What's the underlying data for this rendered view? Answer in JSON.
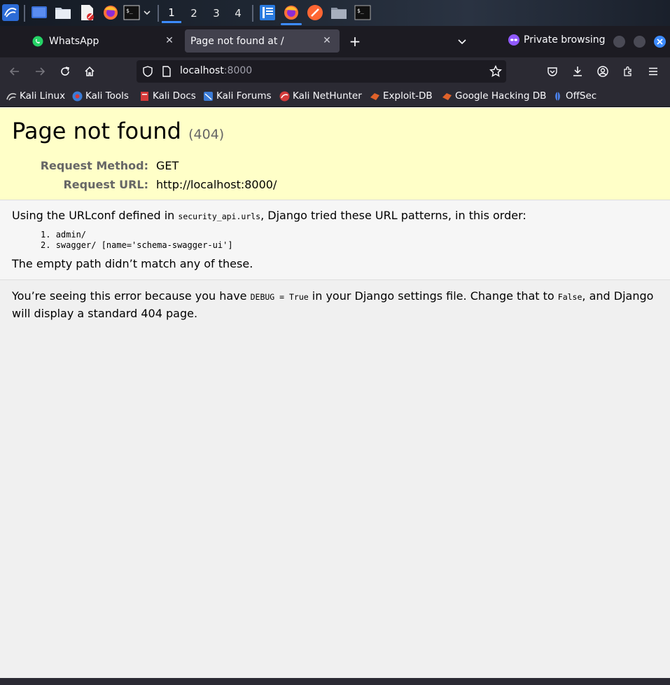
{
  "taskbar": {
    "workspaces": [
      "1",
      "2",
      "3",
      "4"
    ],
    "active_workspace": "1"
  },
  "tabs": [
    {
      "title": "WhatsApp",
      "icon": "whatsapp-icon",
      "active": false
    },
    {
      "title": "Page not found at /",
      "icon": "none",
      "active": true
    }
  ],
  "private_browsing_label": "Private browsing",
  "url": {
    "host": "localhost",
    "port": ":8000"
  },
  "bookmarks": [
    {
      "label": "Kali Linux",
      "icon": "kali-dragon-icon",
      "color": "#d0d0d0"
    },
    {
      "label": "Kali Tools",
      "icon": "kali-tools-icon",
      "color": "#3b7bd6"
    },
    {
      "label": "Kali Docs",
      "icon": "kali-docs-icon",
      "color": "#d43a3a"
    },
    {
      "label": "Kali Forums",
      "icon": "kali-forums-icon",
      "color": "#3b7bd6"
    },
    {
      "label": "Kali NetHunter",
      "icon": "nethunter-icon",
      "color": "#d43a3a"
    },
    {
      "label": "Exploit-DB",
      "icon": "exploit-db-icon",
      "color": "#e0622a"
    },
    {
      "label": "Google Hacking DB",
      "icon": "ghdb-icon",
      "color": "#e0622a"
    },
    {
      "label": "OffSec",
      "icon": "offsec-icon",
      "color": "#4a80e8"
    }
  ],
  "page": {
    "title": "Page not found",
    "status_code": "(404)",
    "request_method_label": "Request Method:",
    "request_method": "GET",
    "request_url_label": "Request URL:",
    "request_url": "http://localhost:8000/",
    "urlconf_prefix": "Using the URLconf defined in ",
    "urlconf_module": "security_api.urls",
    "urlconf_suffix": ", Django tried these URL patterns, in this order:",
    "patterns": [
      "admin/",
      "swagger/ [name='schema-swagger-ui']"
    ],
    "empty_path_message": "The empty path didn’t match any of these.",
    "explanation_part1": "You’re seeing this error because you have ",
    "explanation_code1": "DEBUG = True",
    "explanation_part2": " in your Django settings file. Change that to ",
    "explanation_code2": "False",
    "explanation_part3": ", and Django will display a standard 404 page."
  },
  "colors": {
    "summary_bg": "#ffffc8",
    "private_icon": "#9059ff",
    "close_button": "#3d8bff"
  }
}
